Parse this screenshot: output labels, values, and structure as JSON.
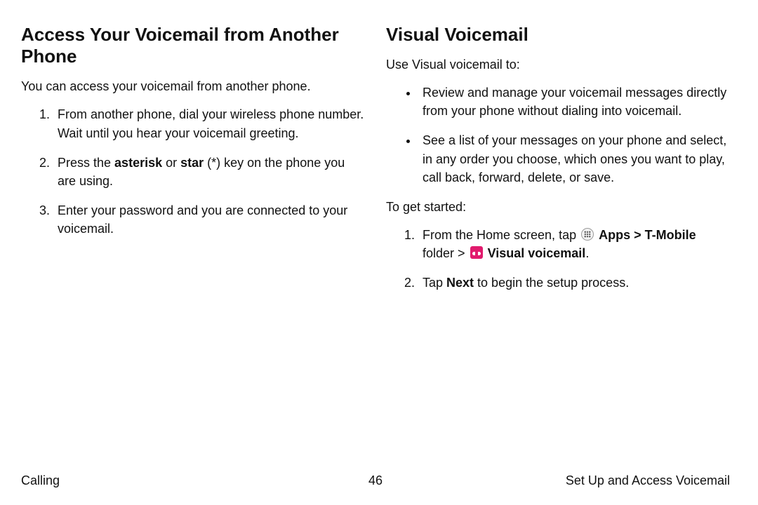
{
  "left": {
    "title": "Access Your Voicemail from Another Phone",
    "intro": "You can access your voicemail from another phone.",
    "steps": {
      "s1": "From another phone, dial your wireless phone number. Wait until you hear your voicemail greeting.",
      "s2_prefix": "Press the ",
      "s2_asterisk": "asterisk",
      "s2_or": " or ",
      "s2_star": "star",
      "s2_suffix": " (*) key on the phone you are using.",
      "s3": "Enter your password and you are connected to your voicemail."
    }
  },
  "right": {
    "title": "Visual Voicemail",
    "intro": "Use Visual voicemail to:",
    "bullets": {
      "b1": "Review and manage your voicemail messages directly from your phone without dialing into voicemail.",
      "b2": "See a list of your messages on your phone and select, in any order you choose, which ones you want to play, call back, forward, delete, or save."
    },
    "get_started": "To get started:",
    "step1": {
      "prefix": "From the Home screen, tap ",
      "apps": "Apps",
      "chev1": " > ",
      "tmobile": "T-Mobile",
      "folder": " folder > ",
      "vv": "Visual voicemail",
      "period": "."
    },
    "step2": {
      "prefix": "Tap ",
      "next": "Next",
      "suffix": " to begin the setup process."
    }
  },
  "footer": {
    "left": "Calling",
    "center": "46",
    "right": "Set Up and Access Voicemail"
  }
}
